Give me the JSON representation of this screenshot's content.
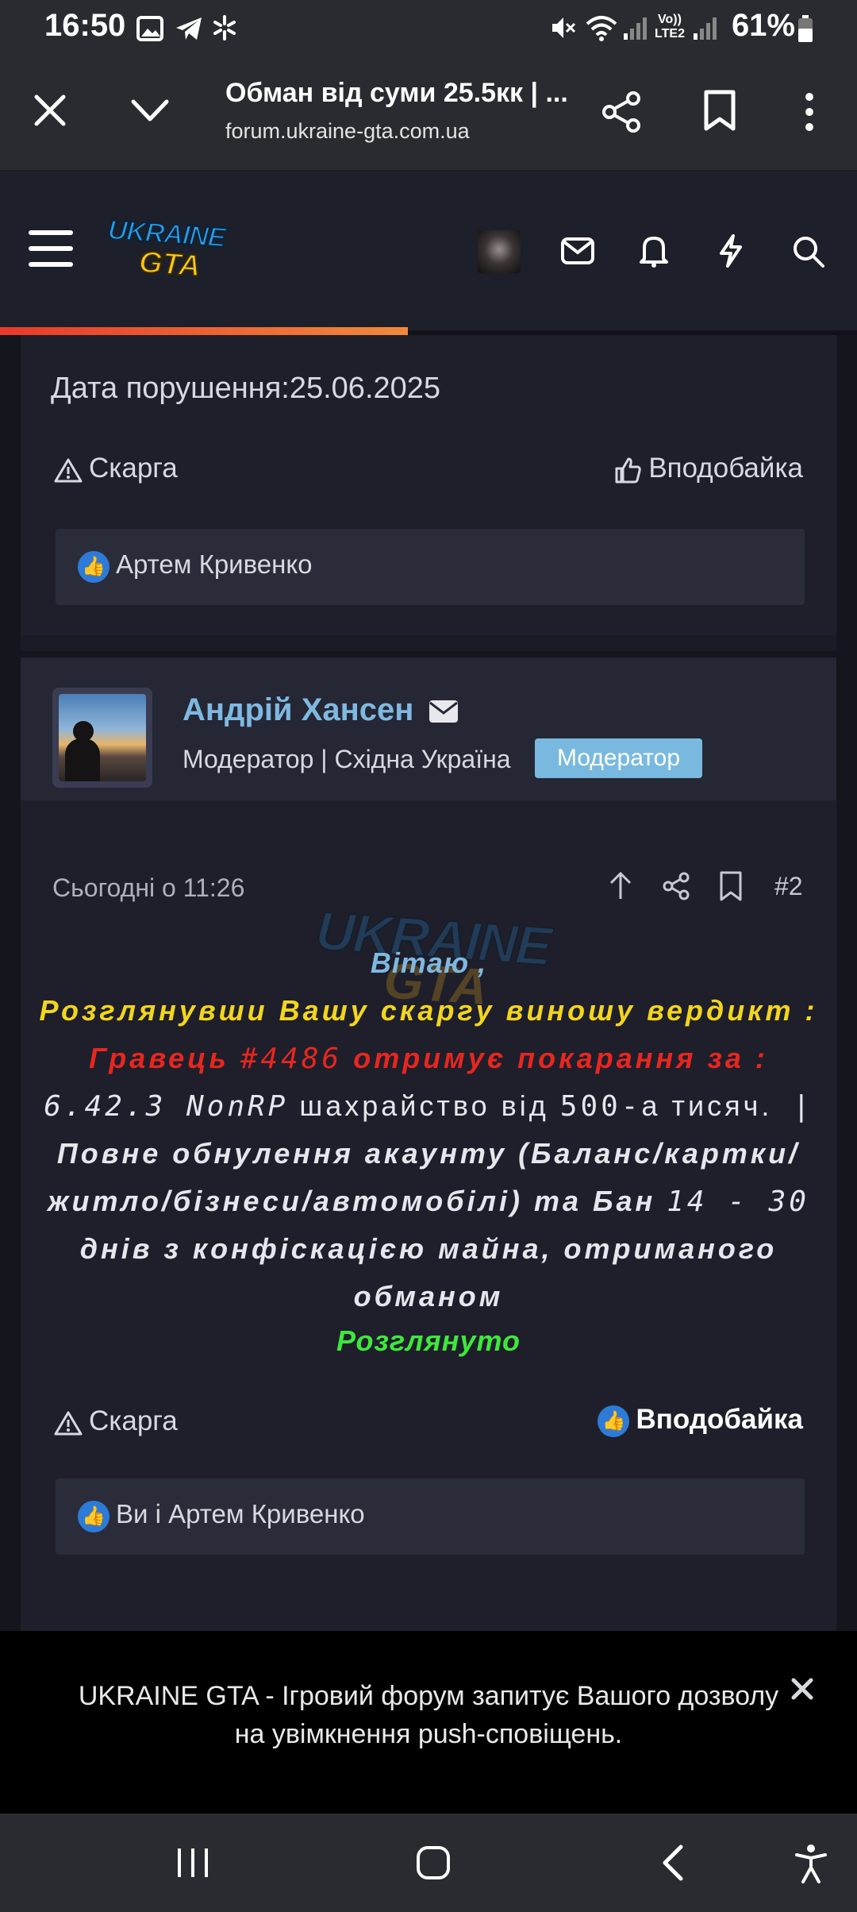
{
  "status_bar": {
    "time": "16:50",
    "battery": "61%",
    "icons": [
      "gallery-icon",
      "telegram-icon",
      "sparkle-icon",
      "mute-icon",
      "wifi-icon",
      "signal-icon",
      "battery-icon"
    ],
    "network_label": "Vo)) LTE2"
  },
  "browser": {
    "title": "Обман від суми 25.5кк | ...",
    "url": "forum.ukraine-gta.com.ua"
  },
  "forum": {
    "logo_text_top": "UKRAINE",
    "logo_text_bottom": "GTA",
    "progress_fraction": 0.476
  },
  "previous_post": {
    "violation_date": "Дата порушення:25.06.2025",
    "report_label": "Скарга",
    "like_label": "Вподобайка",
    "reactions": "Артем Кривенко"
  },
  "post": {
    "author": "Андрій Хансен",
    "author_title": "Модератор | Східна Україна",
    "role_badge": "Модератор",
    "time": "Сьогодні о 11:26",
    "post_number": "#2",
    "watermark_top": "UKRAINE",
    "watermark_bottom": "GTA",
    "greeting": "Вітаю ,",
    "line1": "Розглянувши Вашу скаргу виношу вердикт :",
    "line2a": "Гравець ",
    "line2b": "#4486",
    "line2c": " отримує покарання за :",
    "line3a": "6.42.3 NonRP",
    "line3b": " шахрайство від ",
    "line3c": "500-",
    "line3d": "а тисяч.",
    "line3e": " |",
    "line4": "Повне обнулення акаунту (Баланс/картки/",
    "line5a": "житло/бізнеси/автомобілі) та Бан ",
    "line5b": "14 - 30",
    "line6": "днів з конфіскацією майна, отриманого",
    "line7": "обманом",
    "status": "Розглянуто",
    "report_label": "Скарга",
    "like_label": "Вподобайка",
    "reactions": "Ви і Артем Кривенко"
  },
  "push_prompt": {
    "line1": "UKRAINE GTA - Ігровий форум запитує Вашого дозволу",
    "line2": "на увімкнення push-сповіщень."
  },
  "colors": {
    "accent_blue": "#7fb8e0",
    "verdict_yellow": "#f3d51c",
    "verdict_red": "#e8261f",
    "status_green": "#3ee83b",
    "role_badge_bg": "#79b9e0"
  }
}
